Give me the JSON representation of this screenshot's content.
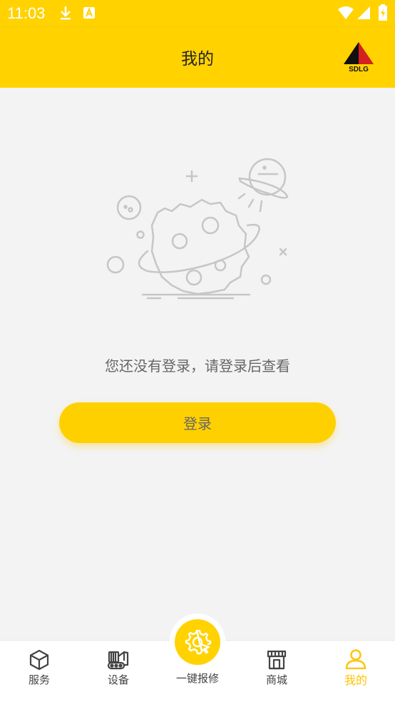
{
  "status_bar": {
    "time": "11:03",
    "icons": [
      "download-icon",
      "a-badge-icon",
      "wifi-icon",
      "signal-icon",
      "battery-icon"
    ]
  },
  "header": {
    "title": "我的",
    "logo_text": "SDLG"
  },
  "main": {
    "empty_message": "您还没有登录，请登录后查看",
    "login_button": "登录"
  },
  "bottom_nav": {
    "items": [
      {
        "label": "服务",
        "icon": "cube-icon"
      },
      {
        "label": "设备",
        "icon": "excavator-icon"
      },
      {
        "label": "一键报修",
        "icon": "gear-cursor-icon"
      },
      {
        "label": "商城",
        "icon": "store-icon"
      },
      {
        "label": "我的",
        "icon": "user-icon"
      }
    ],
    "active_index": 4
  },
  "colors": {
    "brand_yellow": "#ffd200",
    "active_tab": "#ffc400",
    "background": "#f3f3f3"
  }
}
